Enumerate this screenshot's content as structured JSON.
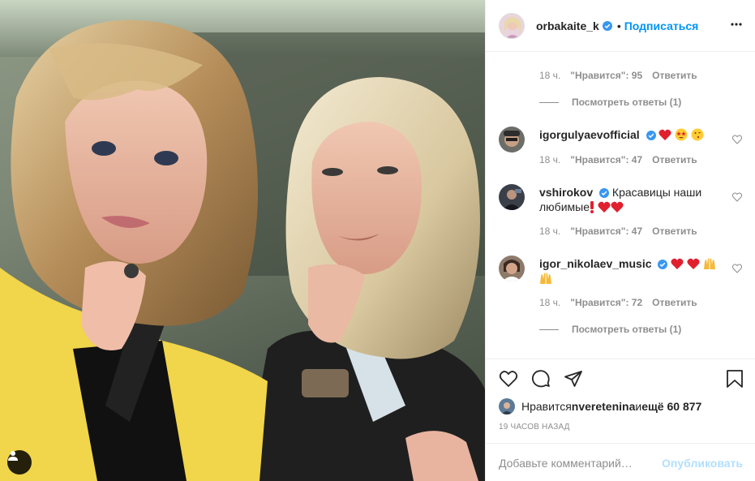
{
  "header": {
    "username": "orbakaite_k",
    "dot": "•",
    "follow_label": "Подписаться"
  },
  "comments": {
    "top_meta": {
      "time": "18 ч.",
      "likes": "\"Нравится\": 95",
      "reply": "Ответить"
    },
    "top_view_replies": "Посмотреть ответы (1)",
    "items": [
      {
        "username": "igorgulyaev­official",
        "text": "",
        "emojis": [
          "red-heart",
          "star-struck",
          "kissing-face"
        ],
        "meta": {
          "time": "18 ч.",
          "likes": "\"Нравится\": 47",
          "reply": "Ответить"
        }
      },
      {
        "username": "vshirokov",
        "text": " Красавицы наши любимые",
        "emojis": [
          "exclamation",
          "red-heart",
          "red-heart"
        ],
        "meta": {
          "time": "18 ч.",
          "likes": "\"Нравится\": 47",
          "reply": "Ответить"
        }
      },
      {
        "username": "igor_nikolaev_music",
        "text": "",
        "emojis": [
          "red-heart",
          "red-heart",
          "raising-hands",
          "raising-hands"
        ],
        "meta": {
          "time": "18 ч.",
          "likes": "\"Нравится\": 72",
          "reply": "Ответить"
        },
        "view_replies": "Посмотреть ответы (1)"
      }
    ]
  },
  "likes": {
    "prefix": "Нравится ",
    "user": "nveretenina",
    "middle": " и ",
    "count": "ещё 60 877"
  },
  "timestamp": "19 часов назад",
  "add_comment": {
    "placeholder": "Добавьте комментарий…",
    "publish_label": "Опубликовать"
  },
  "colors": {
    "accent": "#0095f6",
    "publish_disabled": "#b2dffc",
    "muted": "#8e8e8e",
    "verified": "#3897f0"
  }
}
